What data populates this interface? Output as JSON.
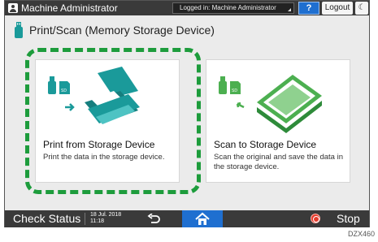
{
  "topbar": {
    "user_name": "Machine Administrator",
    "login_status": "Logged in: Machine Administrator",
    "help_label": "?",
    "logout_label": "Logout",
    "energy_label": "☾"
  },
  "header": {
    "title": "Print/Scan (Memory Storage Device)"
  },
  "cards": [
    {
      "title": "Print from Storage Device",
      "description": "Print the data in the storage device.",
      "highlighted": true
    },
    {
      "title": "Scan to Storage Device",
      "description": "Scan the original and save the data in the storage device.",
      "highlighted": false
    }
  ],
  "bottombar": {
    "check_status_label": "Check Status",
    "date": "18 Jul. 2018",
    "time": "11:18",
    "stop_label": "Stop"
  },
  "footnote": "DZX460",
  "colors": {
    "accent": "#1f6fd0",
    "highlight_dash": "#1d9c3c",
    "icon_teal": "#1a9a9a",
    "icon_green": "#4caf50",
    "stop_red": "#e43b2c"
  },
  "icons": [
    "user-icon",
    "usb-icon",
    "sd-card-icon",
    "printer-icon",
    "scanner-icon",
    "back-arrow-icon",
    "home-icon",
    "stop-icon"
  ]
}
